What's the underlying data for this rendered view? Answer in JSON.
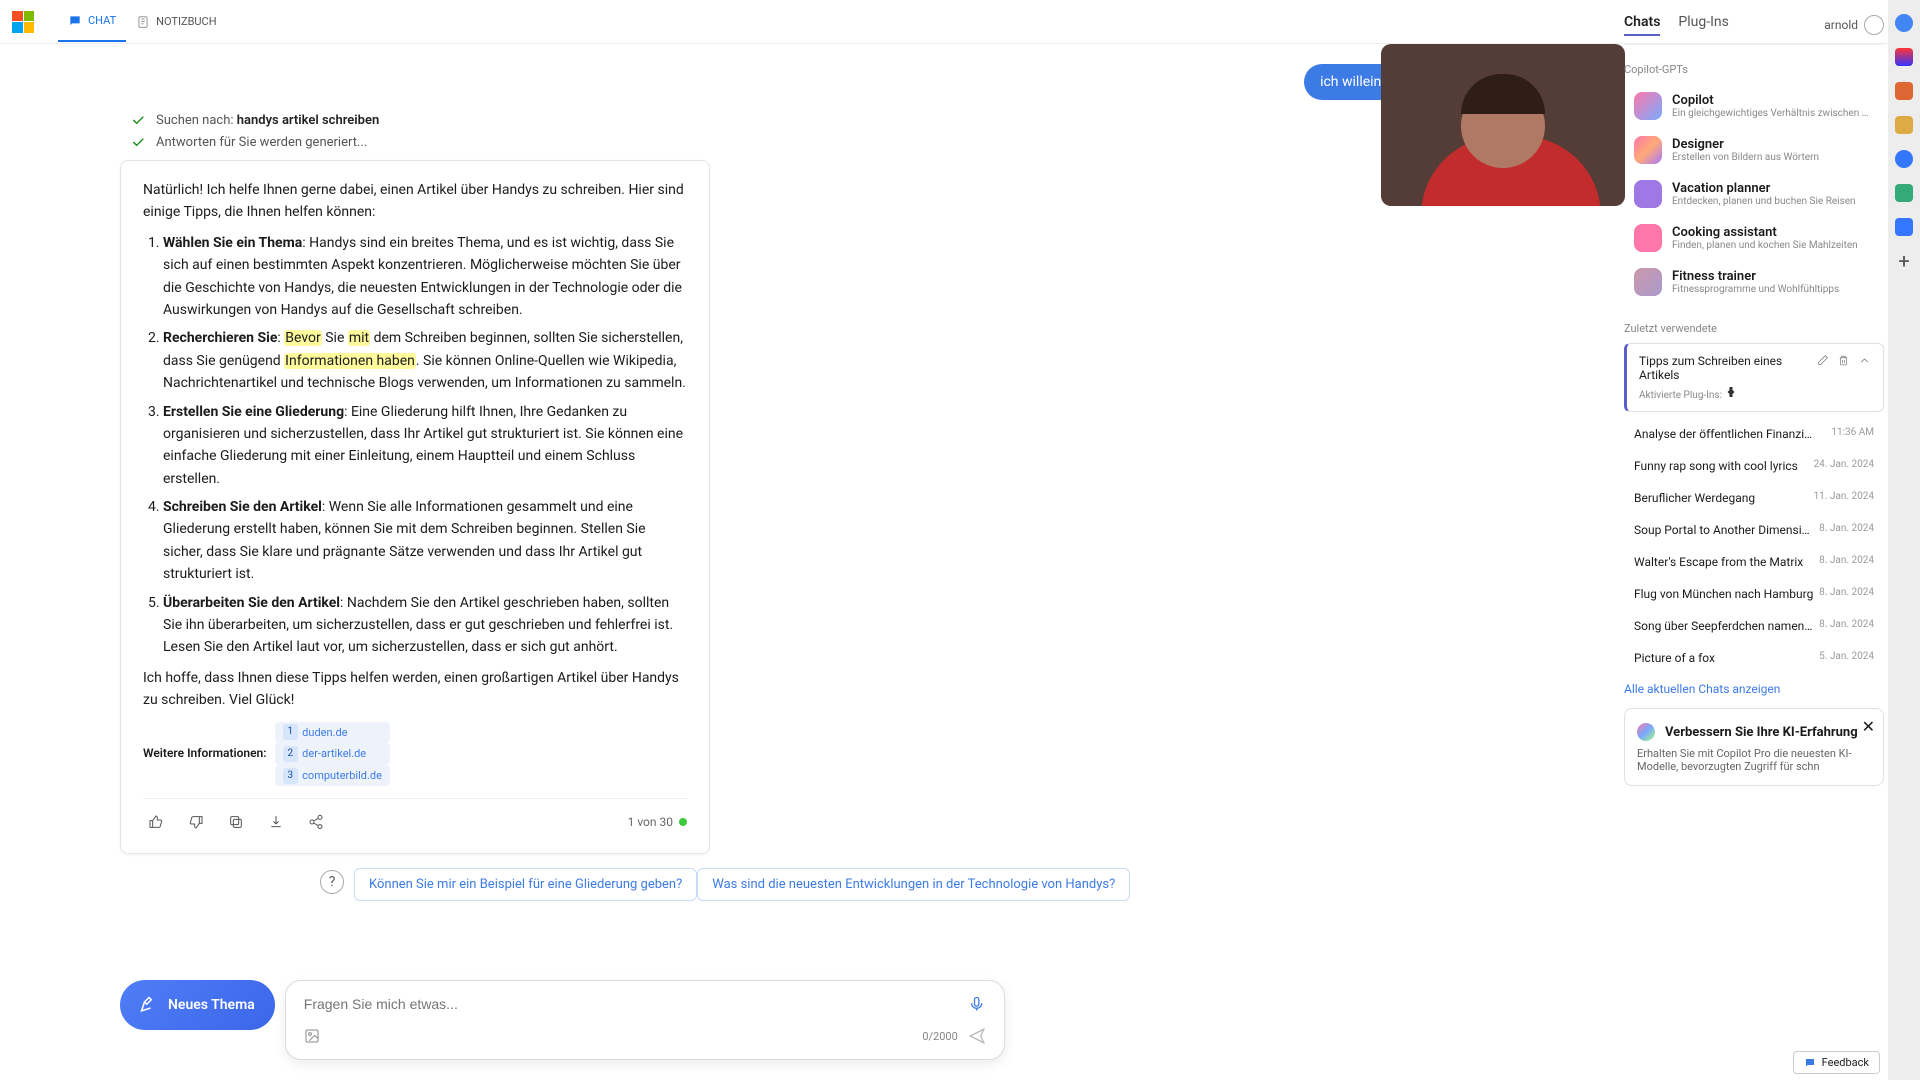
{
  "header": {
    "tab_chat": "CHAT",
    "tab_notebook": "NOTIZBUCH"
  },
  "user_message": "ich willeinen artikel zu handys schreiben",
  "status1_prefix": "Suchen nach: ",
  "status1_bold": "handys artikel schreiben",
  "status2": "Antworten für Sie werden generiert...",
  "answer": {
    "intro": "Natürlich! Ich helfe Ihnen gerne dabei, einen Artikel über Handys zu schreiben. Hier sind einige Tipps, die Ihnen helfen können:",
    "items": [
      {
        "b": "Wählen Sie ein Thema",
        "t": ": Handys sind ein breites Thema, und es ist wichtig, dass Sie sich auf einen bestimmten Aspekt konzentrieren. Möglicherweise möchten Sie über die Geschichte von Handys, die neuesten Entwicklungen in der Technologie oder die Auswirkungen von Handys auf die Gesellschaft schreiben."
      },
      {
        "b": "Recherchieren Sie",
        "t1": ": Bevor Sie mit dem Schreiben beginnen, sollten Sie sicherstellen, dass Sie genügend Informationen haben. Sie können Online-Quellen wie Wikipedia, Nachrichtenartikel und technische Blogs verwenden, um Informationen zu sammeln."
      },
      {
        "b": "Erstellen Sie eine Gliederung",
        "t": ": Eine Gliederung hilft Ihnen, Ihre Gedanken zu organisieren und sicherzustellen, dass Ihr Artikel gut strukturiert ist. Sie können eine einfache Gliederung mit einer Einleitung, einem Hauptteil und einem Schluss erstellen."
      },
      {
        "b": "Schreiben Sie den Artikel",
        "t": ": Wenn Sie alle Informationen gesammelt und eine Gliederung erstellt haben, können Sie mit dem Schreiben beginnen. Stellen Sie sicher, dass Sie klare und prägnante Sätze verwenden und dass Ihr Artikel gut strukturiert ist."
      },
      {
        "b": "Überarbeiten Sie den Artikel",
        "t": ": Nachdem Sie den Artikel geschrieben haben, sollten Sie ihn überarbeiten, um sicherzustellen, dass er gut geschrieben und fehlerfrei ist. Lesen Sie den Artikel laut vor, um sicherzustellen, dass er sich gut anhört."
      }
    ],
    "outro": "Ich hoffe, dass Ihnen diese Tipps helfen werden, einen großartigen Artikel über Handys zu schreiben. Viel Glück!",
    "sources_label": "Weitere Informationen:",
    "sources": [
      {
        "n": "1",
        "d": "duden.de"
      },
      {
        "n": "2",
        "d": "der-artikel.de"
      },
      {
        "n": "3",
        "d": "computerbild.de"
      }
    ],
    "counter": "1 von 30"
  },
  "suggestions": [
    "Können Sie mir ein Beispiel für eine Gliederung geben?",
    "Was sind die neuesten Entwicklungen in der Technologie von Handys?"
  ],
  "compose": {
    "new_topic": "Neues Thema",
    "placeholder": "Fragen Sie mich etwas...",
    "count": "0/2000"
  },
  "right": {
    "tab_chats": "Chats",
    "tab_plugins": "Plug-Ins",
    "username": "arnold",
    "sec_gpts": "Copilot-GPTs",
    "gpts": [
      {
        "title": "Copilot",
        "sub": "Ein gleichgewichtiges Verhältnis zwischen KI u",
        "c": "linear-gradient(135deg,#f7a,#7af)"
      },
      {
        "title": "Designer",
        "sub": "Erstellen von Bildern aus Wörtern",
        "c": "linear-gradient(135deg,#f7a,#fa7,#a7f)"
      },
      {
        "title": "Vacation planner",
        "sub": "Entdecken, planen und buchen Sie Reisen",
        "c": "#a078e6"
      },
      {
        "title": "Cooking assistant",
        "sub": "Finden, planen und kochen Sie Mahlzeiten",
        "c": "#f7a"
      },
      {
        "title": "Fitness trainer",
        "sub": "Fitnessprogramme und Wohlfühltipps",
        "c": "linear-gradient(135deg,#c9a,#a9c)"
      }
    ],
    "sec_recent": "Zuletzt verwendete",
    "active_chat": {
      "title": "Tipps zum Schreiben eines Artikels",
      "sub": "Aktivierte Plug-Ins:"
    },
    "chats": [
      {
        "title": "Analyse der öffentlichen Finanzierung de",
        "time": "11:36 AM"
      },
      {
        "title": "Funny rap song with cool lyrics",
        "time": "24. Jan. 2024"
      },
      {
        "title": "Beruflicher Werdegang",
        "time": "11. Jan. 2024"
      },
      {
        "title": "Soup Portal to Another Dimension",
        "time": "8. Jan. 2024"
      },
      {
        "title": "Walter's Escape from the Matrix",
        "time": "8. Jan. 2024"
      },
      {
        "title": "Flug von München nach Hamburg",
        "time": "8. Jan. 2024"
      },
      {
        "title": "Song über Seepferdchen namens Bub",
        "time": "8. Jan. 2024"
      },
      {
        "title": "Picture of a fox",
        "time": "5. Jan. 2024"
      }
    ],
    "show_all": "Alle aktuellen Chats anzeigen",
    "promo": {
      "title": "Verbessern Sie Ihre KI-Erfahrung",
      "desc": "Erhalten Sie mit Copilot Pro die neuesten KI-Modelle, bevorzugten Zugriff für schn"
    }
  },
  "feedback": "Feedback"
}
